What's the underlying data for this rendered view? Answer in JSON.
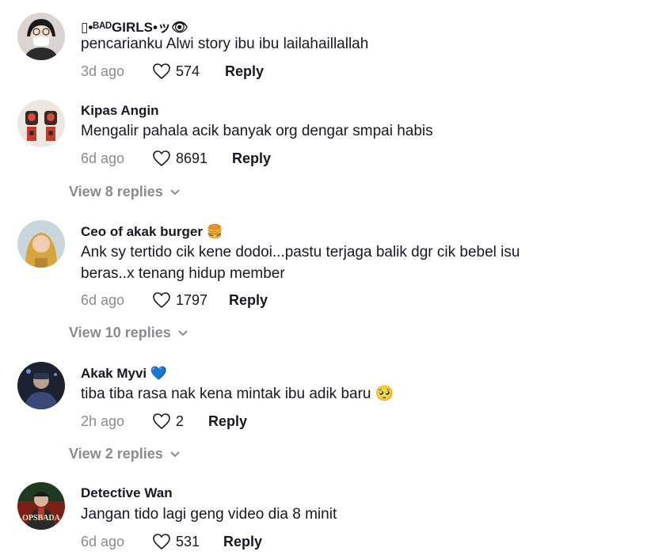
{
  "comments": [
    {
      "username": "▯•ᴮᴬᴰGIRLS•ッ👁",
      "text": "pencarianku Alwi story ibu ibu lailahaillallah",
      "date": "3d ago",
      "likes": "574",
      "reply": "Reply"
    },
    {
      "username": "Kipas Angin",
      "text": "Mengalir pahala acik banyak org dengar smpai habis",
      "date": "6d ago",
      "likes": "8691",
      "reply": "Reply",
      "view_replies": "View 8 replies"
    },
    {
      "username": "Ceo of akak burger",
      "username_emoji": "🍔",
      "text_line1": "Ank sy tertido cik kene dodoi...pastu terjaga balik dgr cik bebel isu",
      "text_line2": "beras..x tenang hidup member",
      "date": "6d ago",
      "likes": "1797",
      "reply": "Reply",
      "view_replies": "View 10 replies"
    },
    {
      "username": "Akak Myvi",
      "username_emoji": "💙",
      "text": "tiba tiba rasa nak kena mintak ibu adik baru",
      "text_emoji": "🥺",
      "date": "2h ago",
      "likes": "2",
      "reply": "Reply",
      "view_replies": "View 2 replies"
    },
    {
      "username": "Detective Wan",
      "text": "Jangan tido lagi geng video dia 8 minit",
      "date": "6d ago",
      "likes": "531",
      "reply": "Reply",
      "avatar_text": "OPSBADA"
    }
  ],
  "colors": {
    "primary_text": "#161823",
    "secondary_text": "#8a8b91",
    "background": "#ffffff"
  },
  "icons": {
    "like": "heart-outline-icon",
    "expand": "chevron-down-icon"
  }
}
